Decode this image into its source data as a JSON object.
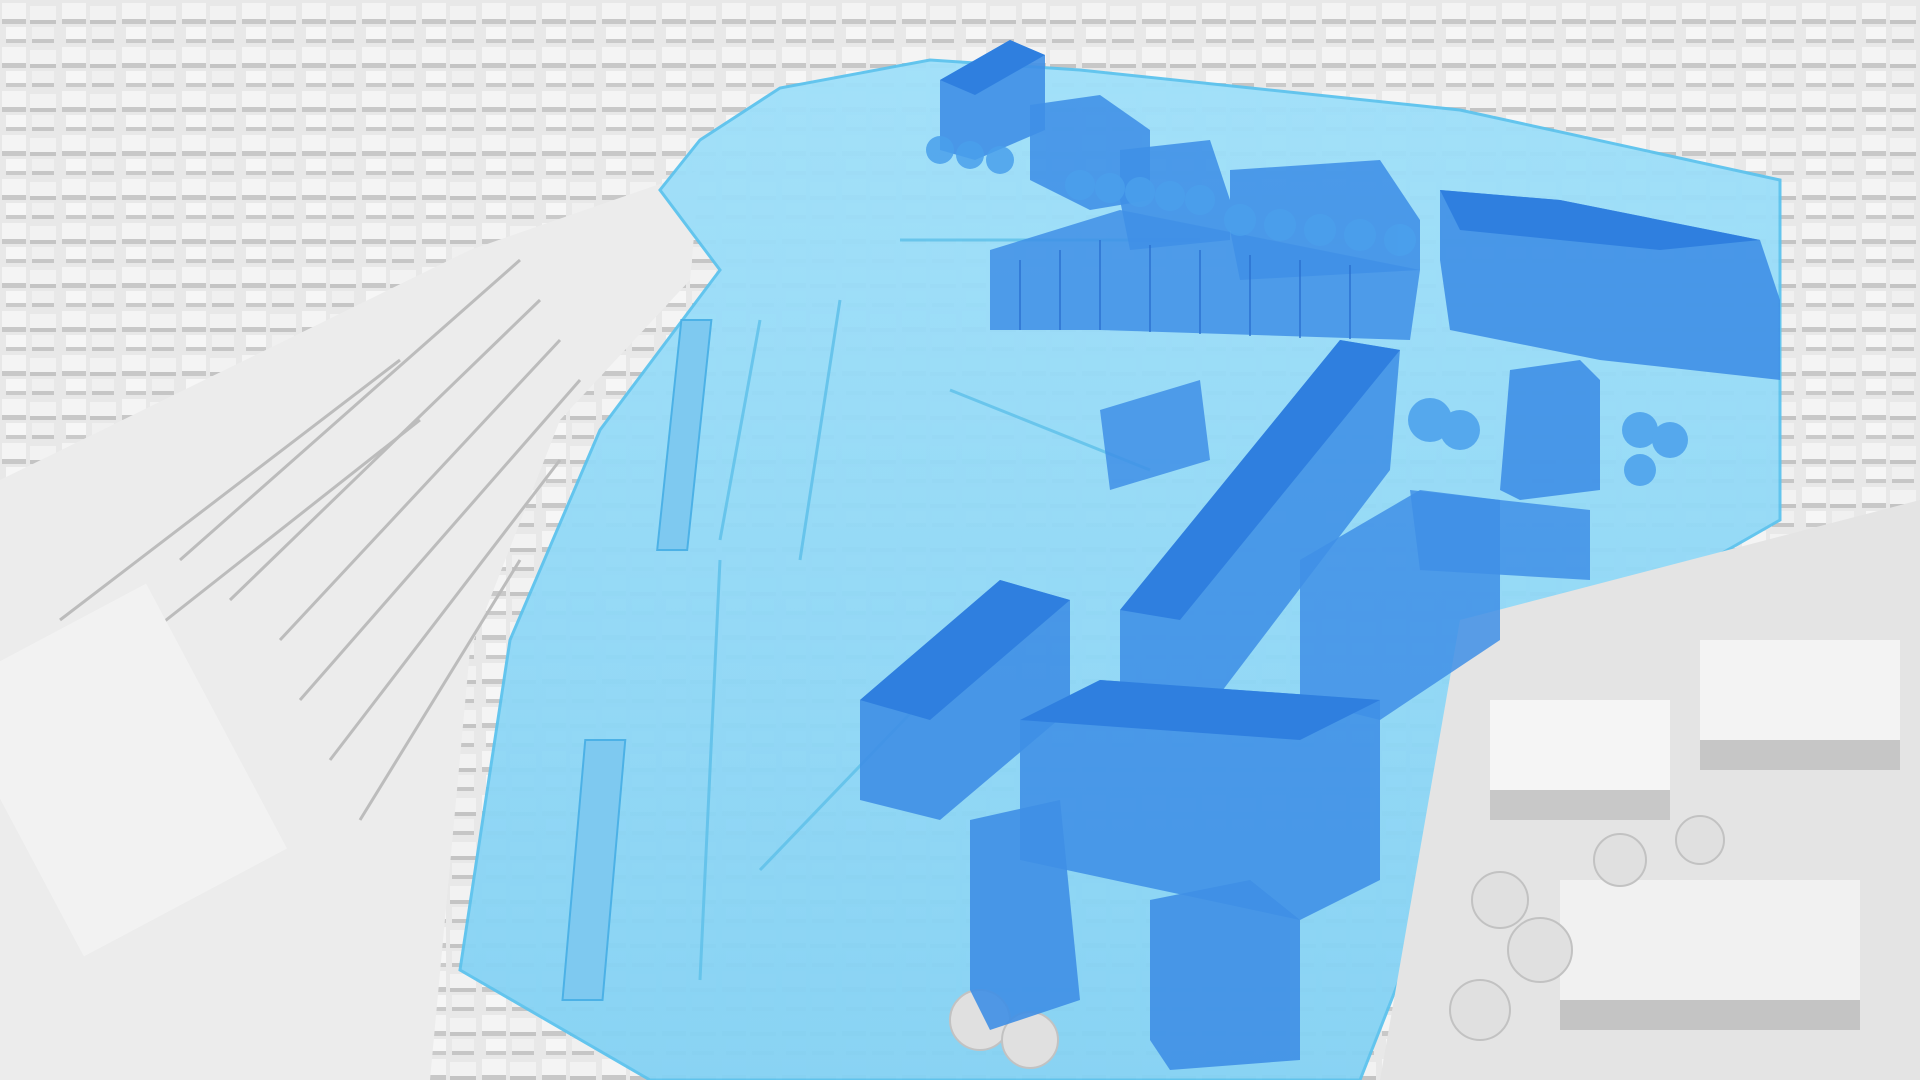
{
  "scene": {
    "type": "3d-urban-model-render",
    "palette": {
      "background": "#dcdcdc",
      "city_block": "#eeeeee",
      "city_block_shade": "#c9c9c9",
      "city_roof": "#f7f7f7",
      "rail_yard": "#e6e6e6",
      "rail_track": "#bdbdbd",
      "highlight_zone": "#8fd8f6",
      "highlight_zone_edge": "#5cc3ee",
      "building_face": "#3f8fe6",
      "building_top": "#2f7fdf",
      "building_shade": "#2a6fd0",
      "tree": "#4aa0ec"
    }
  }
}
